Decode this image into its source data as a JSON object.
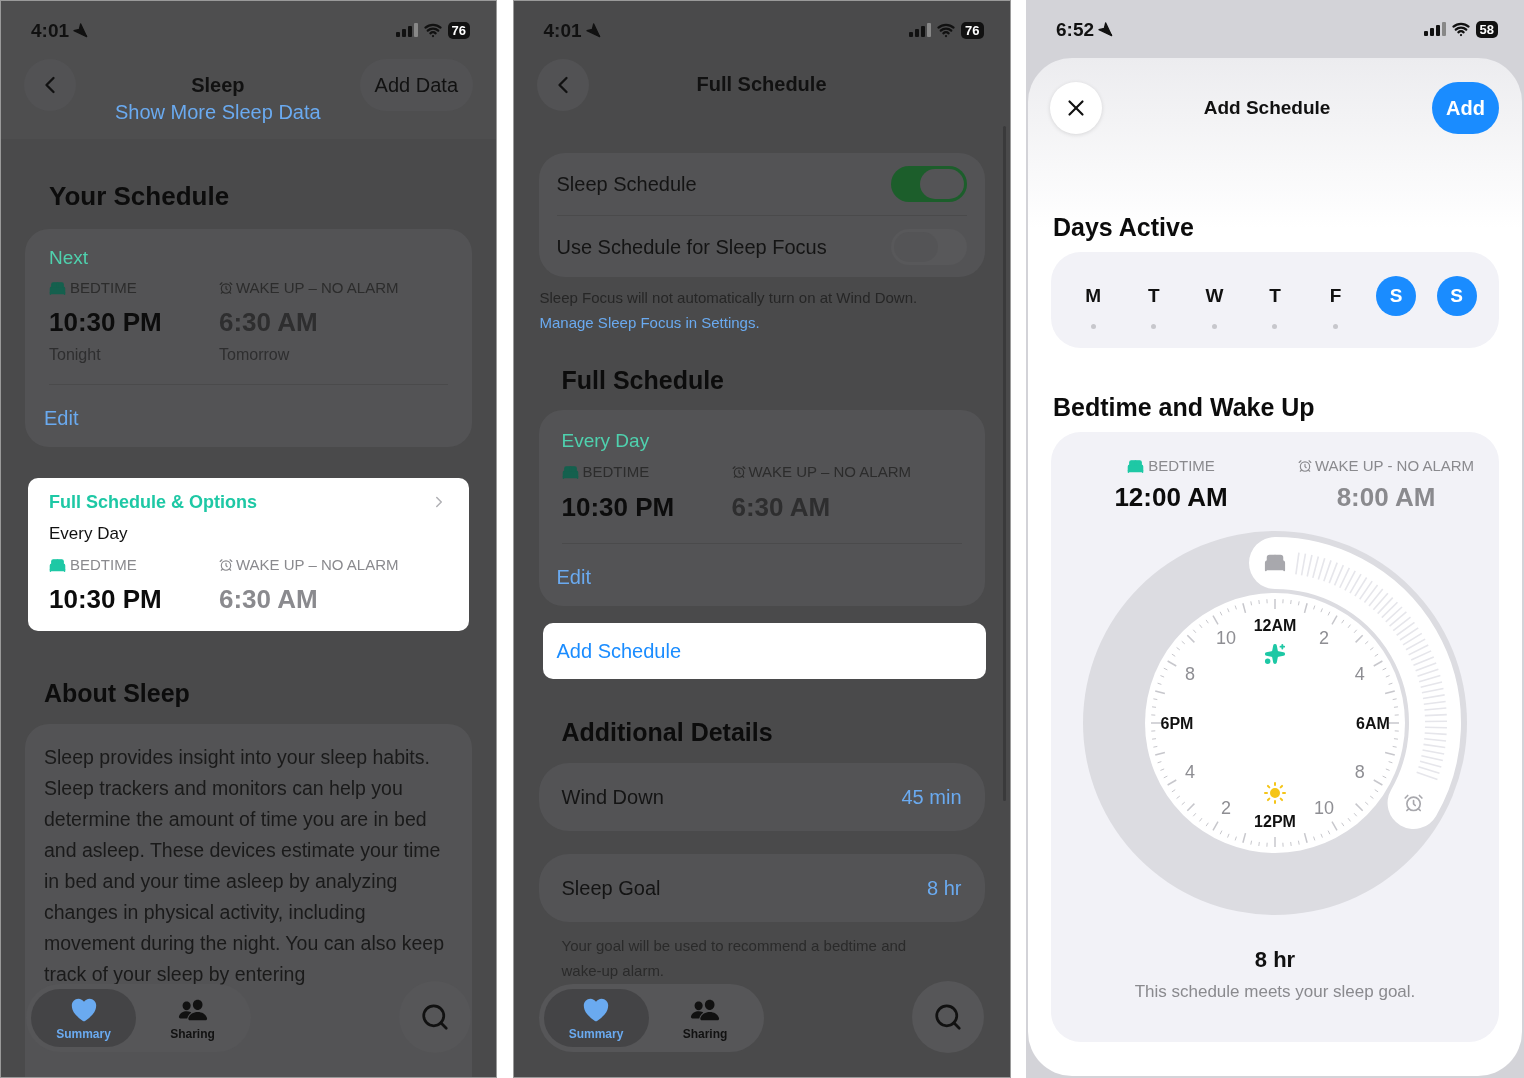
{
  "sleep_screen": {
    "status_bar": {
      "time": "4:01",
      "battery": "76"
    },
    "nav": {
      "title": "Sleep",
      "link": "Show More Sleep Data",
      "action": "Add Data"
    },
    "schedule_heading": "Your Schedule",
    "next_card": {
      "tag": "Next",
      "bedtime_label": "BEDTIME",
      "wake_label": "WAKE UP – NO ALARM",
      "bedtime": "10:30 PM",
      "wake": "6:30 AM",
      "bedtime_day": "Tonight",
      "wake_day": "Tomorrow",
      "edit": "Edit"
    },
    "options_card": {
      "title": "Full Schedule & Options",
      "days": "Every Day",
      "bedtime_label": "BEDTIME",
      "wake_label": "WAKE UP – NO ALARM",
      "bedtime": "10:30 PM",
      "wake": "6:30 AM"
    },
    "about_heading": "About Sleep",
    "about_text": "Sleep provides insight into your sleep habits. Sleep trackers and monitors can help you determine the amount of time you are in bed and asleep. These devices estimate your time in bed and your time asleep by analyzing changes in physical activity, including movement during the night. You can also keep track of your sleep by entering",
    "tabs": [
      {
        "label": "Summary",
        "selected": true
      },
      {
        "label": "Sharing",
        "selected": false
      }
    ]
  },
  "full_schedule_screen": {
    "status_bar": {
      "time": "4:01",
      "battery": "76"
    },
    "nav": {
      "title": "Full Schedule"
    },
    "toggles": [
      {
        "label": "Sleep Schedule",
        "on": true
      },
      {
        "label": "Use Schedule for Sleep Focus",
        "on": false
      }
    ],
    "focus_note": "Sleep Focus will not automatically turn on at Wind Down.",
    "focus_link": "Manage Sleep Focus in Settings.",
    "schedule_heading": "Full Schedule",
    "schedule_card": {
      "days": "Every Day",
      "bedtime_label": "BEDTIME",
      "wake_label": "WAKE UP – NO ALARM",
      "bedtime": "10:30 PM",
      "wake": "6:30 AM",
      "edit": "Edit"
    },
    "add_button": "Add Schedule",
    "details_heading": "Additional Details",
    "details": [
      {
        "label": "Wind Down",
        "value": "45 min"
      },
      {
        "label": "Sleep Goal",
        "value": "8 hr"
      }
    ],
    "goal_note": "Your goal will be used to recommend a bedtime and wake-up alarm.",
    "tabs": [
      {
        "label": "Summary",
        "selected": true
      },
      {
        "label": "Sharing",
        "selected": false
      }
    ]
  },
  "add_schedule_screen": {
    "status_bar": {
      "time": "6:52",
      "battery": "58"
    },
    "nav": {
      "title": "Add Schedule",
      "action": "Add"
    },
    "days_heading": "Days Active",
    "days": [
      {
        "label": "M",
        "selected": false
      },
      {
        "label": "T",
        "selected": false
      },
      {
        "label": "W",
        "selected": false
      },
      {
        "label": "T",
        "selected": false
      },
      {
        "label": "F",
        "selected": false
      },
      {
        "label": "S",
        "selected": true
      },
      {
        "label": "S",
        "selected": true
      }
    ],
    "times_heading": "Bedtime and Wake Up",
    "bedtime_label": "BEDTIME",
    "wake_label": "WAKE UP - NO ALARM",
    "bedtime": "12:00 AM",
    "wake": "8:00 AM",
    "clock_labels": {
      "top": {
        "label": "12AM",
        "kind": "major"
      },
      "left": [
        {
          "label": "10",
          "kind": "minor"
        },
        {
          "label": "8",
          "kind": "minor"
        },
        {
          "label": "6PM",
          "kind": "major"
        },
        {
          "label": "4",
          "kind": "minor"
        },
        {
          "label": "2",
          "kind": "minor"
        }
      ],
      "right": [
        {
          "label": "2",
          "kind": "minor"
        },
        {
          "label": "4",
          "kind": "minor"
        },
        {
          "label": "6AM",
          "kind": "major"
        },
        {
          "label": "8",
          "kind": "minor"
        },
        {
          "label": "10",
          "kind": "minor"
        }
      ],
      "bottom": {
        "label": "12PM",
        "kind": "major"
      }
    },
    "duration": "8 hr",
    "goal_message": "This schedule meets your sleep goal."
  }
}
